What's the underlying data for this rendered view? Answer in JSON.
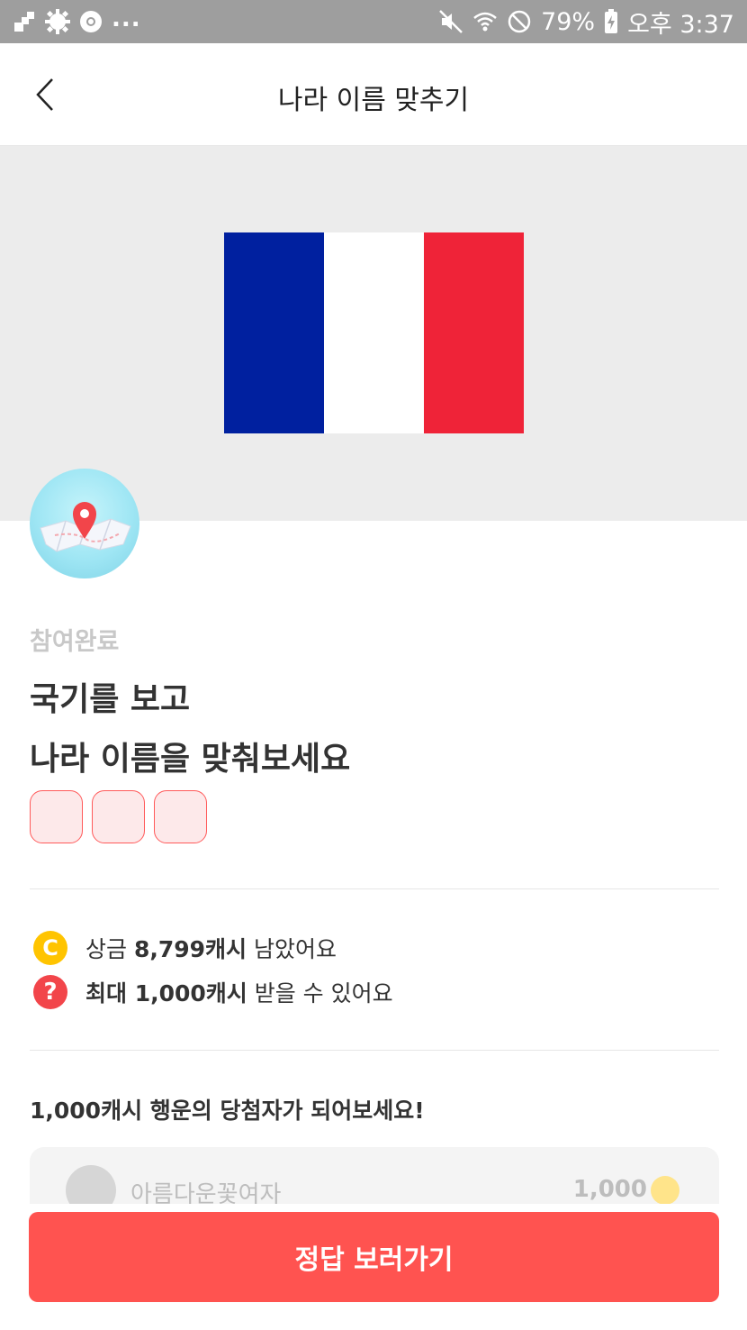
{
  "status_bar": {
    "battery": "79%",
    "time": "오후 3:37",
    "overflow": "..."
  },
  "header": {
    "title": "나라 이름 맞추기"
  },
  "flag": {
    "colors": [
      "#00209f",
      "#ffffff",
      "#ef2338"
    ]
  },
  "quiz": {
    "status": "참여완료",
    "question_line1": "국기를 보고",
    "question_line2": "나라 이름을 맞춰보세요",
    "answer_box_count": 3
  },
  "rewards": {
    "prize_prefix": "상금 ",
    "prize_amount": "8,799캐시",
    "prize_suffix": " 남았어요",
    "max_prefix": "최대 1,000캐시",
    "max_suffix": " 받을 수 있어요",
    "coin_icon": "C",
    "help_icon": "?"
  },
  "winners": {
    "heading": "1,000캐시 행운의 당첨자가 되어보세요!",
    "items": [
      {
        "name": "아름다운꽃여자",
        "amount": "1,000"
      }
    ]
  },
  "cta": {
    "label": "정답 보러가기"
  },
  "colors": {
    "accent": "#ff5350",
    "coin": "#ffc400",
    "help": "#f2454a"
  }
}
